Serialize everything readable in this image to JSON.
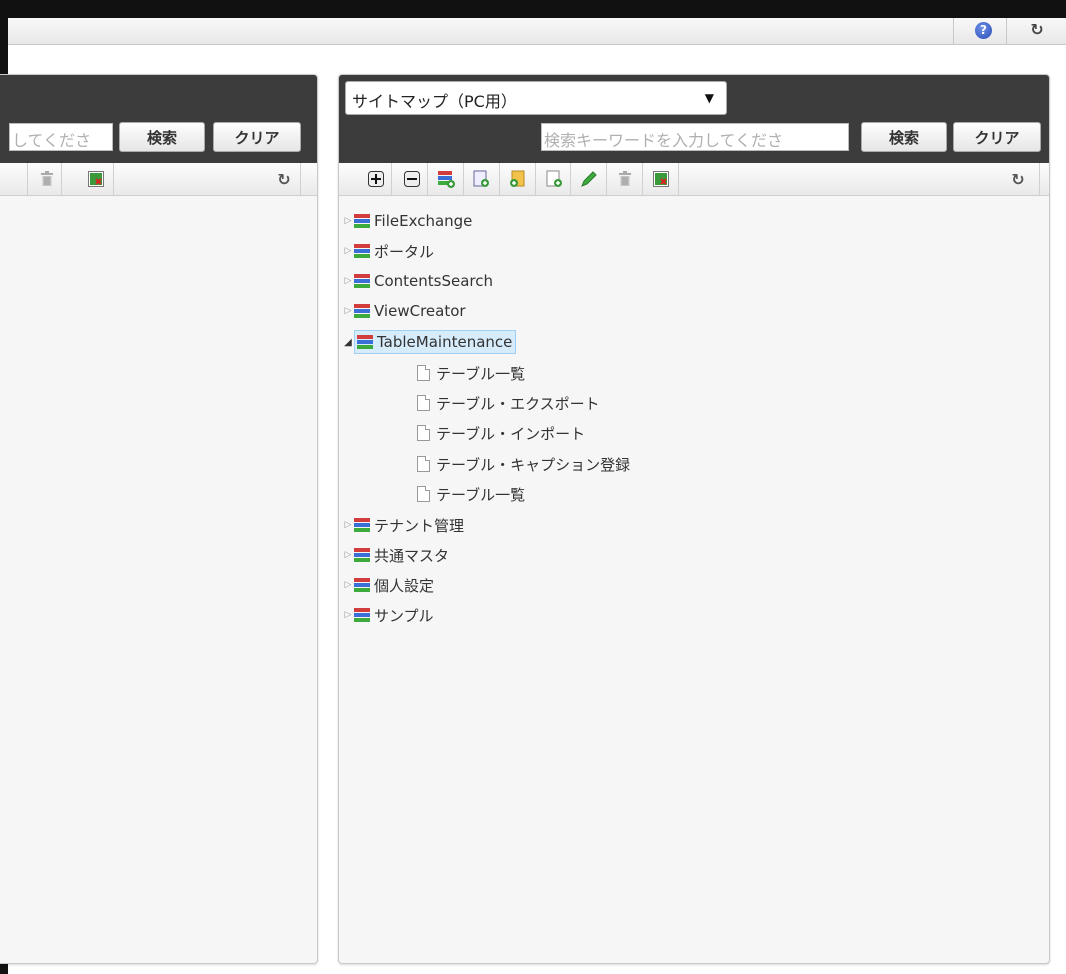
{
  "topbar": {
    "help_icon": "help-icon",
    "reload_icon": "reload-icon"
  },
  "left_panel": {
    "search_placeholder_visible": "してくださ",
    "search_button": "検索",
    "clear_button": "クリア",
    "toolbar_icons": [
      "trash-icon",
      "csv-icon",
      "reload-icon"
    ]
  },
  "right_panel": {
    "select_value": "サイトマップ（PC用）",
    "search_placeholder": "検索キーワードを入力してくださ",
    "search_button": "検索",
    "clear_button": "クリア",
    "toolbar_icons": [
      "expand-all-icon",
      "collapse-all-icon",
      "add-menu-icon",
      "add-page-icon",
      "add-folder-icon",
      "add-item-icon",
      "edit-icon",
      "trash-icon",
      "csv-icon",
      "reload-icon"
    ],
    "tree": [
      {
        "label": "FileExchange",
        "type": "group",
        "expanded": false
      },
      {
        "label": "ポータル",
        "type": "group",
        "expanded": false
      },
      {
        "label": "ContentsSearch",
        "type": "group",
        "expanded": false
      },
      {
        "label": "ViewCreator",
        "type": "group",
        "expanded": false
      },
      {
        "label": "TableMaintenance",
        "type": "group",
        "expanded": true,
        "selected": true
      },
      {
        "label": "テーブル一覧",
        "type": "page"
      },
      {
        "label": "テーブル・エクスポート",
        "type": "page"
      },
      {
        "label": "テーブル・インポート",
        "type": "page"
      },
      {
        "label": "テーブル・キャプション登録",
        "type": "page"
      },
      {
        "label": "テーブル一覧",
        "type": "page"
      },
      {
        "label": "テナント管理",
        "type": "group",
        "expanded": false
      },
      {
        "label": "共通マスタ",
        "type": "group",
        "expanded": false
      },
      {
        "label": "個人設定",
        "type": "group",
        "expanded": false
      },
      {
        "label": "サンプル",
        "type": "group",
        "expanded": false
      }
    ]
  },
  "colors": {
    "panel_header": "#3c3c3c",
    "selection_bg": "#d7ecfb",
    "icon_red": "#d23c3c",
    "icon_blue": "#3a6fd8",
    "icon_green": "#3caa3c"
  }
}
